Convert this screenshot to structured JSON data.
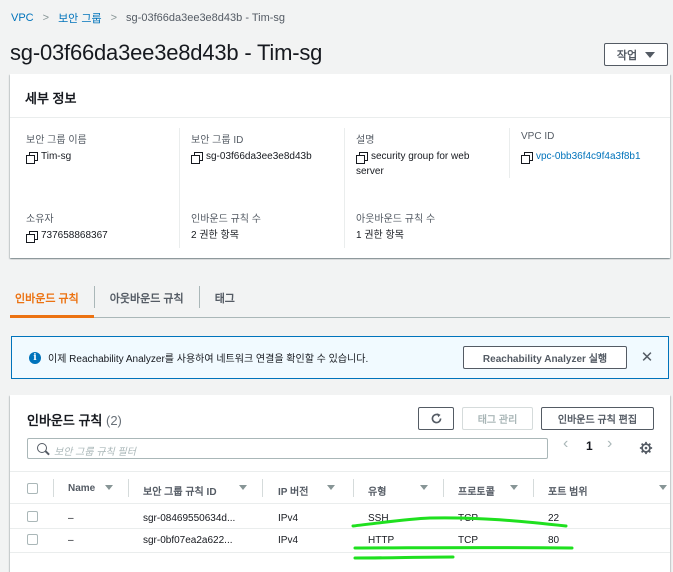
{
  "breadcrumb": {
    "root": "VPC",
    "parent": "보안 그룹",
    "current": "sg-03f66da3ee3e8d43b - Tim-sg",
    "separator": ">"
  },
  "page": {
    "title": "sg-03f66da3ee3e8d43b - Tim-sg",
    "action_label": "작업"
  },
  "details": {
    "header": "세부 정보",
    "fields": [
      {
        "label": "보안 그룹 이름",
        "value": "Tim-sg"
      },
      {
        "label": "보안 그룹 ID",
        "value": "sg-03f66da3ee3e8d43b"
      },
      {
        "label": "설명",
        "value_line1": "security group for web",
        "value_line2": "server"
      },
      {
        "label": "VPC ID",
        "value": "vpc-0bb36f4c9f4a3f8b1"
      },
      {
        "label": "소유자",
        "value": "737658868367"
      },
      {
        "label": "인바운드 규칙 수",
        "value": "2 권한 항목"
      },
      {
        "label": "아웃바운드 규칙 수",
        "value": "1 권한 항목"
      }
    ]
  },
  "tabs": [
    "인바운드 규칙",
    "아웃바운드 규칙",
    "태그"
  ],
  "alert": {
    "icon": "info-icon",
    "text": "이제 Reachability Analyzer를 사용하여 네트워크 연결을 확인할 수 있습니다.",
    "button": "Reachability Analyzer 실행",
    "close": "✕"
  },
  "rules": {
    "title": "인바운드 규칙",
    "count": "(2)",
    "manage_tags": "태그 관리",
    "edit_button": "인바운드 규칙 편집",
    "search_placeholder": "보안 그룹 규칙 필터",
    "page": "1",
    "prev": "‹",
    "next": "›",
    "columns": [
      "Name",
      "보안 그룹 규칙 ID",
      "IP 버전",
      "유형",
      "프로토콜",
      "포트 범위"
    ],
    "rows": [
      {
        "name": "–",
        "rule_id": "sgr-08469550634d...",
        "ip_version": "IPv4",
        "type": "SSH",
        "protocol": "TCP",
        "port": "22"
      },
      {
        "name": "–",
        "rule_id": "sgr-0bf07ea2a622...",
        "ip_version": "IPv4",
        "type": "HTTP",
        "protocol": "TCP",
        "port": "80"
      }
    ]
  },
  "colors": {
    "link": "#0073bb",
    "accent": "#ec7211",
    "highlight": "#1fe01f"
  }
}
